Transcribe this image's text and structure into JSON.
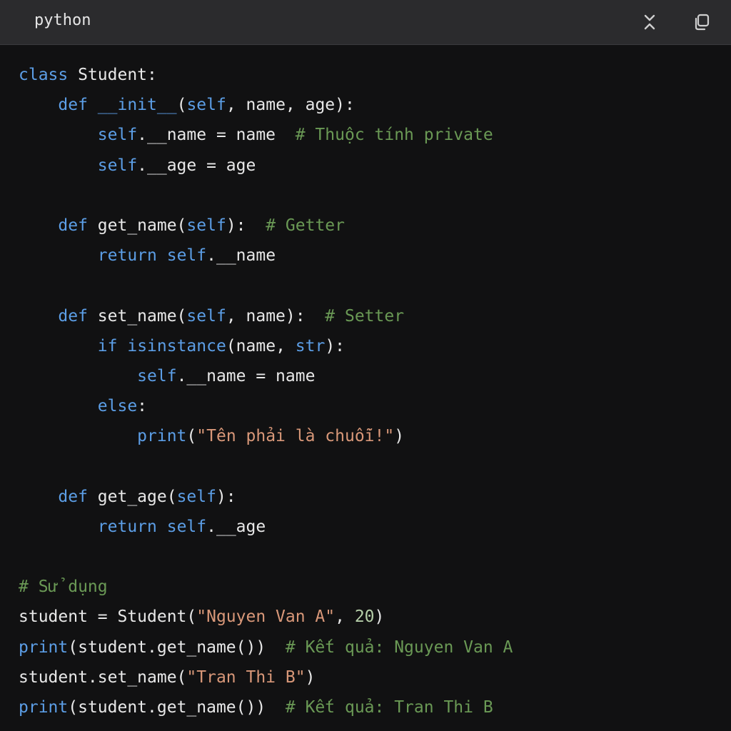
{
  "header": {
    "language": "python",
    "collapse_icon": "collapse-icon",
    "copy_icon": "copy-icon"
  },
  "colors": {
    "background": "#111112",
    "header_background": "#2b2b2d",
    "keyword": "#5c9ee6",
    "comment": "#6a9955",
    "string": "#d99879",
    "number": "#b5cea8",
    "text": "#e8e8e8"
  },
  "code": {
    "lines": [
      [
        {
          "t": "class",
          "c": "keyword"
        },
        {
          "t": " Student:",
          "c": "default"
        }
      ],
      [
        {
          "t": "    ",
          "c": "default"
        },
        {
          "t": "def",
          "c": "keyword"
        },
        {
          "t": " ",
          "c": "default"
        },
        {
          "t": "__init__",
          "c": "keyword"
        },
        {
          "t": "(",
          "c": "default"
        },
        {
          "t": "self",
          "c": "self"
        },
        {
          "t": ", name, age):",
          "c": "default"
        }
      ],
      [
        {
          "t": "        ",
          "c": "default"
        },
        {
          "t": "self",
          "c": "self"
        },
        {
          "t": ".__name = name  ",
          "c": "default"
        },
        {
          "t": "# Thuộc tính private",
          "c": "comment"
        }
      ],
      [
        {
          "t": "        ",
          "c": "default"
        },
        {
          "t": "self",
          "c": "self"
        },
        {
          "t": ".__age = age",
          "c": "default"
        }
      ],
      [],
      [
        {
          "t": "    ",
          "c": "default"
        },
        {
          "t": "def",
          "c": "keyword"
        },
        {
          "t": " get_name(",
          "c": "default"
        },
        {
          "t": "self",
          "c": "self"
        },
        {
          "t": "):  ",
          "c": "default"
        },
        {
          "t": "# Getter",
          "c": "comment"
        }
      ],
      [
        {
          "t": "        ",
          "c": "default"
        },
        {
          "t": "return",
          "c": "keyword"
        },
        {
          "t": " ",
          "c": "default"
        },
        {
          "t": "self",
          "c": "self"
        },
        {
          "t": ".__name",
          "c": "default"
        }
      ],
      [],
      [
        {
          "t": "    ",
          "c": "default"
        },
        {
          "t": "def",
          "c": "keyword"
        },
        {
          "t": " set_name(",
          "c": "default"
        },
        {
          "t": "self",
          "c": "self"
        },
        {
          "t": ", name):  ",
          "c": "default"
        },
        {
          "t": "# Setter",
          "c": "comment"
        }
      ],
      [
        {
          "t": "        ",
          "c": "default"
        },
        {
          "t": "if",
          "c": "keyword"
        },
        {
          "t": " ",
          "c": "default"
        },
        {
          "t": "isinstance",
          "c": "builtin"
        },
        {
          "t": "(name, ",
          "c": "default"
        },
        {
          "t": "str",
          "c": "builtin"
        },
        {
          "t": "):",
          "c": "default"
        }
      ],
      [
        {
          "t": "            ",
          "c": "default"
        },
        {
          "t": "self",
          "c": "self"
        },
        {
          "t": ".__name = name",
          "c": "default"
        }
      ],
      [
        {
          "t": "        ",
          "c": "default"
        },
        {
          "t": "else",
          "c": "keyword"
        },
        {
          "t": ":",
          "c": "default"
        }
      ],
      [
        {
          "t": "            ",
          "c": "default"
        },
        {
          "t": "print",
          "c": "builtin"
        },
        {
          "t": "(",
          "c": "default"
        },
        {
          "t": "\"Tên phải là chuỗi!\"",
          "c": "string"
        },
        {
          "t": ")",
          "c": "default"
        }
      ],
      [],
      [
        {
          "t": "    ",
          "c": "default"
        },
        {
          "t": "def",
          "c": "keyword"
        },
        {
          "t": " get_age(",
          "c": "default"
        },
        {
          "t": "self",
          "c": "self"
        },
        {
          "t": "):",
          "c": "default"
        }
      ],
      [
        {
          "t": "        ",
          "c": "default"
        },
        {
          "t": "return",
          "c": "keyword"
        },
        {
          "t": " ",
          "c": "default"
        },
        {
          "t": "self",
          "c": "self"
        },
        {
          "t": ".__age",
          "c": "default"
        }
      ],
      [],
      [
        {
          "t": "# Sử dụng",
          "c": "comment"
        }
      ],
      [
        {
          "t": "student = Student(",
          "c": "default"
        },
        {
          "t": "\"Nguyen Van A\"",
          "c": "string"
        },
        {
          "t": ", ",
          "c": "default"
        },
        {
          "t": "20",
          "c": "number"
        },
        {
          "t": ")",
          "c": "default"
        }
      ],
      [
        {
          "t": "print",
          "c": "builtin"
        },
        {
          "t": "(student.get_name())  ",
          "c": "default"
        },
        {
          "t": "# Kết quả: Nguyen Van A",
          "c": "comment"
        }
      ],
      [
        {
          "t": "student.set_name(",
          "c": "default"
        },
        {
          "t": "\"Tran Thi B\"",
          "c": "string"
        },
        {
          "t": ")",
          "c": "default"
        }
      ],
      [
        {
          "t": "print",
          "c": "builtin"
        },
        {
          "t": "(student.get_name())  ",
          "c": "default"
        },
        {
          "t": "# Kết quả: Tran Thi B",
          "c": "comment"
        }
      ]
    ]
  }
}
